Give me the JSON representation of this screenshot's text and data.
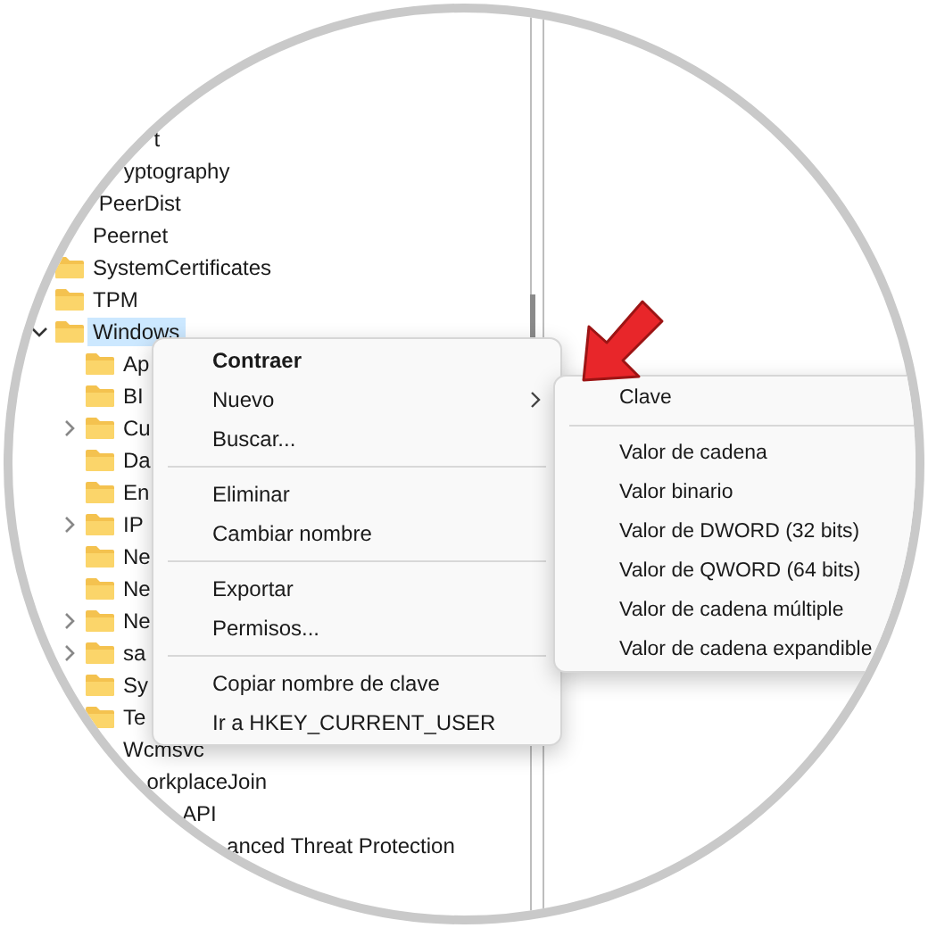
{
  "tree": [
    {
      "label": "t",
      "kind": "leaf",
      "selected": false
    },
    {
      "label": "yptography",
      "kind": "leaf",
      "selected": false
    },
    {
      "label": "PeerDist",
      "kind": "leaf",
      "selected": false
    },
    {
      "label": "Peernet",
      "kind": "leaf",
      "selected": false
    },
    {
      "label": "SystemCertificates",
      "kind": "leaf",
      "selected": false
    },
    {
      "label": "TPM",
      "kind": "leaf",
      "selected": false
    },
    {
      "label": "Windows",
      "kind": "branch",
      "expanded": true,
      "selected": true,
      "children": [
        {
          "label": "Ap",
          "kind": "leaf",
          "selected": false
        },
        {
          "label": "BI",
          "kind": "leaf",
          "selected": false
        },
        {
          "label": "Cu",
          "kind": "branch",
          "expanded": false,
          "selected": false
        },
        {
          "label": "Da",
          "kind": "leaf",
          "selected": false
        },
        {
          "label": "En",
          "kind": "leaf",
          "selected": false
        },
        {
          "label": "IP",
          "kind": "branch",
          "expanded": false,
          "selected": false
        },
        {
          "label": "Ne",
          "kind": "leaf",
          "selected": false
        },
        {
          "label": "Ne",
          "kind": "leaf",
          "selected": false
        },
        {
          "label": "Ne",
          "kind": "branch",
          "expanded": false,
          "selected": false
        },
        {
          "label": "sa",
          "kind": "branch",
          "expanded": false,
          "selected": false
        },
        {
          "label": "Sy",
          "kind": "leaf",
          "selected": false
        },
        {
          "label": "Te",
          "kind": "leaf",
          "selected": false
        },
        {
          "label": "Wcmsvc",
          "kind": "leaf",
          "selected": false
        },
        {
          "label": "orkplaceJoin",
          "kind": "leaf",
          "selected": false
        },
        {
          "label": "API",
          "kind": "leaf",
          "selected": false
        },
        {
          "label": "anced Threat Protection",
          "kind": "leaf",
          "selected": false
        }
      ]
    }
  ],
  "context_menu": [
    {
      "kind": "item",
      "label": "Contraer",
      "default": true,
      "submenu": false
    },
    {
      "kind": "item",
      "label": "Nuevo",
      "default": false,
      "submenu": true
    },
    {
      "kind": "item",
      "label": "Buscar...",
      "default": false,
      "submenu": false
    },
    {
      "kind": "separator"
    },
    {
      "kind": "item",
      "label": "Eliminar",
      "default": false,
      "submenu": false
    },
    {
      "kind": "item",
      "label": "Cambiar nombre",
      "default": false,
      "submenu": false
    },
    {
      "kind": "separator"
    },
    {
      "kind": "item",
      "label": "Exportar",
      "default": false,
      "submenu": false
    },
    {
      "kind": "item",
      "label": "Permisos...",
      "default": false,
      "submenu": false
    },
    {
      "kind": "separator"
    },
    {
      "kind": "item",
      "label": "Copiar nombre de clave",
      "default": false,
      "submenu": false
    },
    {
      "kind": "item",
      "label": "Ir a HKEY_CURRENT_USER",
      "default": false,
      "submenu": false
    }
  ],
  "submenu": [
    {
      "kind": "item",
      "label": "Clave"
    },
    {
      "kind": "separator"
    },
    {
      "kind": "item",
      "label": "Valor de cadena"
    },
    {
      "kind": "item",
      "label": "Valor binario"
    },
    {
      "kind": "item",
      "label": "Valor de DWORD (32 bits)"
    },
    {
      "kind": "item",
      "label": "Valor de QWORD (64 bits)"
    },
    {
      "kind": "item",
      "label": "Valor de cadena múltiple"
    },
    {
      "kind": "item",
      "label": "Valor de cadena expandible"
    }
  ]
}
